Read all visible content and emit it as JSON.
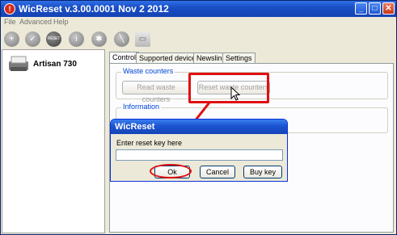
{
  "window": {
    "title": "WicReset v.3.00.0001 Nov  2 2012",
    "icon": "alert-circle-icon",
    "controls": {
      "minimize": "_",
      "maximize": "□",
      "close": "✕"
    }
  },
  "menu": {
    "items": [
      "File",
      "Advanced",
      "Help"
    ]
  },
  "toolbar": {
    "icons": [
      "plus-icon",
      "check-icon",
      "reset-icon",
      "info-icon",
      "bug-icon",
      "tool-icon",
      "book-icon"
    ],
    "reset_label": "RESET"
  },
  "sidebar": {
    "printer_name": "Artisan 730"
  },
  "tabs": [
    "Control",
    "Supported devices",
    "Newsline",
    "Settings"
  ],
  "waste": {
    "legend": "Waste counters",
    "read_label": "Read waste counters",
    "reset_label": "Reset waste counters"
  },
  "info": {
    "legend": "Information"
  },
  "dialog": {
    "title": "WicReset",
    "prompt": "Enter reset key here",
    "input_value": "",
    "ok_label": "Ok",
    "cancel_label": "Cancel",
    "buy_label": "Buy key"
  },
  "colors": {
    "title_bar": "#1a4fc4",
    "highlight": "#e01010",
    "legend": "#0046d5"
  }
}
